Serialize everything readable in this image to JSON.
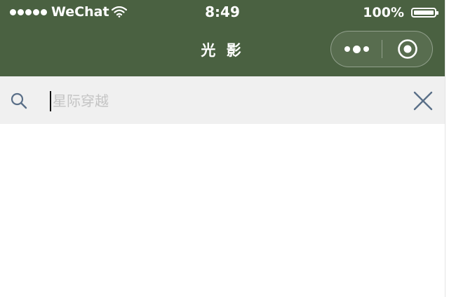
{
  "status_bar": {
    "carrier": "WeChat",
    "time": "8:49",
    "battery_percent": "100%",
    "signal_bars": 5,
    "battery_level": 1.0
  },
  "nav": {
    "title": "光 影",
    "capsule_icons": [
      "more-icon",
      "close-target-icon"
    ]
  },
  "search": {
    "placeholder": "星际穿越",
    "value": "",
    "icons": [
      "search-icon",
      "clear-icon"
    ]
  },
  "colors": {
    "nav_background": "#4a6141",
    "search_background": "#f0f0f0",
    "icon_accent": "#5a6f88",
    "placeholder": "#c4c4c4"
  }
}
